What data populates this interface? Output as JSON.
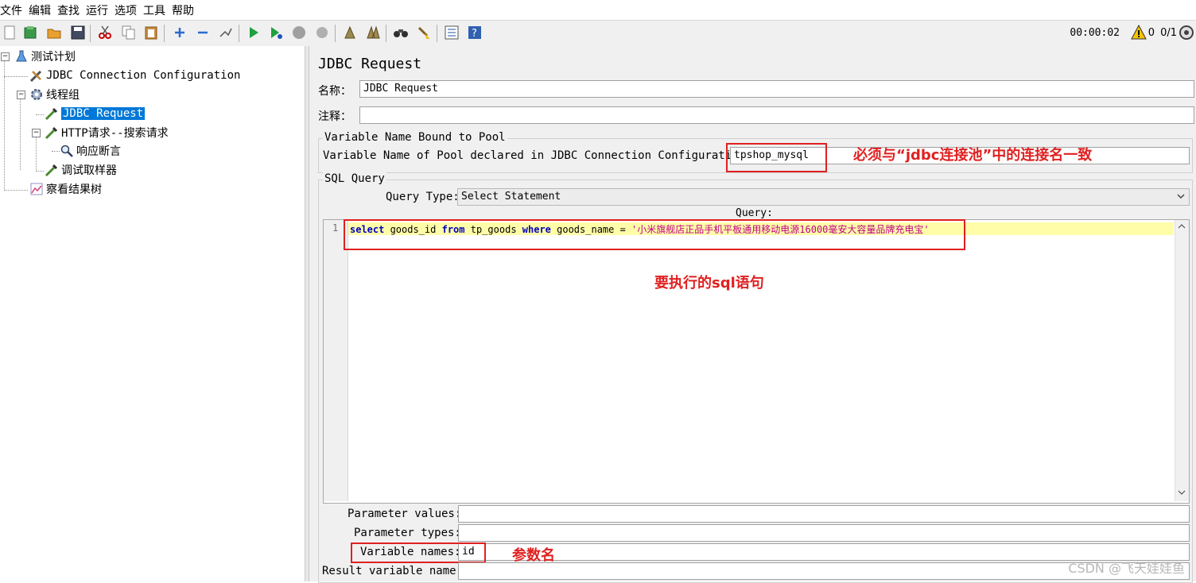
{
  "menu": [
    "文件",
    "编辑",
    "查找",
    "运行",
    "选项",
    "工具",
    "帮助"
  ],
  "toolbar": {
    "timer": "00:00:02",
    "warning_count": "0",
    "thread_ratio": "0/1"
  },
  "tree": {
    "plan": "测试计划",
    "jdbc_config": "JDBC Connection Configuration",
    "thread_group": "线程组",
    "jdbc_request": "JDBC Request",
    "http_request": "HTTP请求--搜索请求",
    "assertion": "响应断言",
    "debug_sampler": "调试取样器",
    "result_tree": "察看结果树"
  },
  "panel": {
    "title": "JDBC Request",
    "name_label": "名称：",
    "name_value": "JDBC Request",
    "comment_label": "注释：",
    "comment_value": "",
    "pool_group_title": "Variable Name Bound to Pool",
    "pool_label": "Variable Name of Pool declared in JDBC Connection Configuration:",
    "pool_value": "tpshop_mysql",
    "sql_group_title": "SQL Query",
    "query_type_label": "Query Type:",
    "query_type_value": "Select Statement",
    "query_label": "Query:",
    "line_number": "1",
    "sql": {
      "kw_select": "select",
      "t1": " goods_id ",
      "kw_from": "from",
      "t2": " tp_goods ",
      "kw_where": "where",
      "t3": " goods_name = ",
      "literal": "'小米旗舰店正品手机平板通用移动电源16000毫安大容量品牌充电宝'"
    },
    "param_values_label": "Parameter values:",
    "param_values": "",
    "param_types_label": "Parameter types:",
    "param_types": "",
    "var_names_label": "Variable names:",
    "var_names": "id",
    "result_var_label": "Result variable name:",
    "result_var": ""
  },
  "annotations": {
    "pool_note": "必须与“jdbc连接池”中的连接名一致",
    "sql_note": "要执行的sql语句",
    "var_note": "参数名"
  },
  "watermark": "CSDN @飞天娃娃鱼",
  "colors": {
    "annotation_red": "#e02020",
    "selection_blue": "#0078d7",
    "keyword_blue": "#0000c0",
    "string_magenta": "#c0008a",
    "line_highlight": "#fffda8"
  }
}
